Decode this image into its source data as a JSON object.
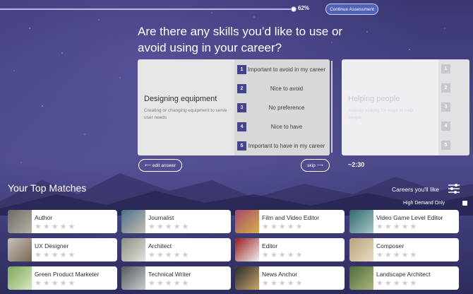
{
  "progress": {
    "percent_label": "62%",
    "value": 0.62
  },
  "continue_label": "Continue Assessment",
  "question": "Are there any skills you’d like to use or avoid using in your career?",
  "current_card": {
    "title": "Designing equipment",
    "description": "Creating or changing equipment to serve user needs",
    "options": [
      {
        "num": "1",
        "label": "Important to avoid in my career"
      },
      {
        "num": "2",
        "label": "Nice to avoid"
      },
      {
        "num": "3",
        "label": "No preference"
      },
      {
        "num": "4",
        "label": "Nice to have"
      },
      {
        "num": "5",
        "label": "Important to have in my career"
      }
    ]
  },
  "next_card": {
    "title": "Helping people",
    "description": "Actively looking for ways to help people",
    "option_nums": [
      "1",
      "2",
      "3",
      "4",
      "5"
    ]
  },
  "edit_label": "⟵ edit answer",
  "skip_label": "skip ⟶",
  "timer": "~2:30",
  "matches": {
    "title": "Your Top Matches",
    "careers_like": "Careers you'll like",
    "high_demand": "High Demand Only",
    "careers": [
      {
        "name": "Author"
      },
      {
        "name": "Journalist"
      },
      {
        "name": "Film and Video Editor"
      },
      {
        "name": "Video Game Level Editor"
      },
      {
        "name": "UX Designer"
      },
      {
        "name": "Architect"
      },
      {
        "name": "Editor"
      },
      {
        "name": "Composer"
      },
      {
        "name": "Green Product Marketer"
      },
      {
        "name": "Technical Writer"
      },
      {
        "name": "News Anchor"
      },
      {
        "name": "Landscape Architect"
      }
    ]
  },
  "colors": {
    "accent": "#45438a",
    "continue_button": "#4e63b8"
  }
}
